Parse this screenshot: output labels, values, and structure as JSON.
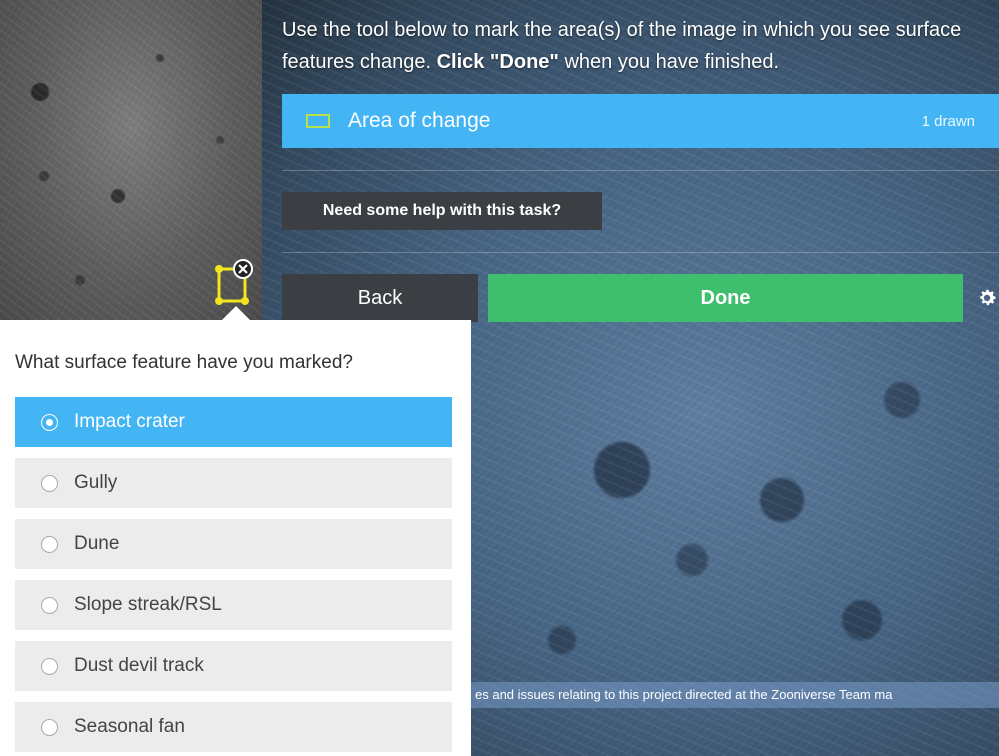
{
  "instruction": {
    "text_before": "Use the tool below to mark the area(s) of the image in which you see surface features change. ",
    "bold": "Click \"Done\"",
    "text_after": " when you have finished."
  },
  "tool": {
    "label": "Area of change",
    "count": "1 drawn",
    "icon": "rectangle-icon",
    "icon_color": "#b8e04a",
    "bg_color": "#43b5f5"
  },
  "help_button": "Need some help with this task?",
  "back_button": "Back",
  "done_button": "Done",
  "colors": {
    "done": "#3fbe6e",
    "dark_button": "#3b3e43",
    "selected": "#43b5f5",
    "marker": "#f2e51d"
  },
  "popup": {
    "question": "What surface feature have you marked?",
    "options": [
      {
        "label": "Impact crater",
        "selected": true
      },
      {
        "label": "Gully",
        "selected": false
      },
      {
        "label": "Dune",
        "selected": false
      },
      {
        "label": "Slope streak/RSL",
        "selected": false
      },
      {
        "label": "Dust devil track",
        "selected": false
      },
      {
        "label": "Seasonal fan",
        "selected": false
      }
    ]
  },
  "footer_strip": "es and issues relating to this project directed at the Zooniverse Team ma"
}
